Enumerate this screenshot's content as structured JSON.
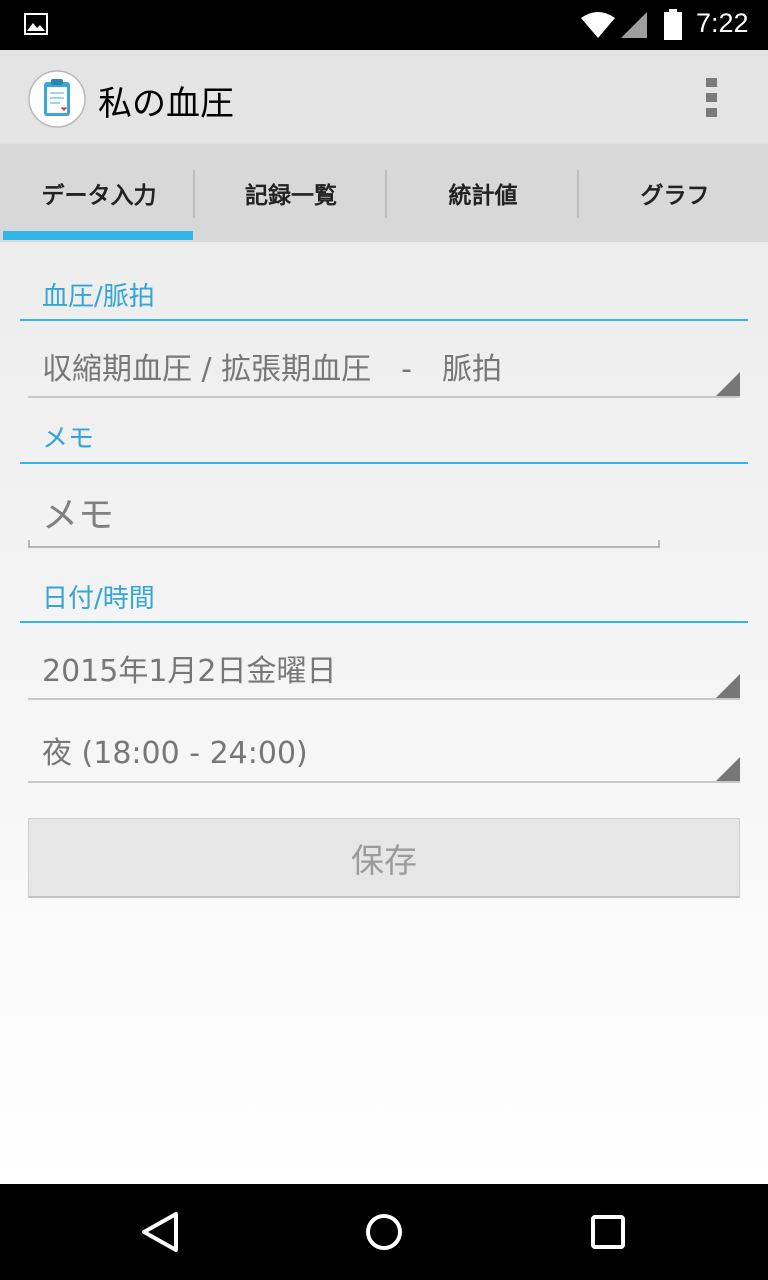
{
  "status_bar": {
    "time": "7:22",
    "icons": [
      "image-notification-icon",
      "wifi-icon",
      "cell-signal-icon",
      "battery-icon"
    ]
  },
  "app_bar": {
    "title": "私の血圧",
    "icon": "clipboard-app-icon",
    "menu_icon": "overflow-menu-icon"
  },
  "tabs": [
    {
      "label": "データ入力",
      "selected": true
    },
    {
      "label": "記録一覧",
      "selected": false
    },
    {
      "label": "統計値",
      "selected": false
    },
    {
      "label": "グラフ",
      "selected": false
    }
  ],
  "form": {
    "bp_section": {
      "label": "血圧/脈拍",
      "spinner_value": "収縮期血圧 / 拡張期血圧　-　脈拍"
    },
    "memo_section": {
      "label": "メモ",
      "placeholder": "メモ",
      "value": ""
    },
    "datetime_section": {
      "label": "日付/時間",
      "date_value": "2015年1月2日金曜日",
      "time_value": "夜 (18:00 - 24:00)"
    },
    "save_label": "保存"
  },
  "colors": {
    "accent": "#33b5e5",
    "app_bar_bg": "#e4e4e4",
    "tab_bar_bg": "#d8d8d8",
    "status_bar_bg": "#000000"
  },
  "nav_bar": {
    "icons": [
      "back-icon",
      "home-icon",
      "recents-icon"
    ]
  }
}
